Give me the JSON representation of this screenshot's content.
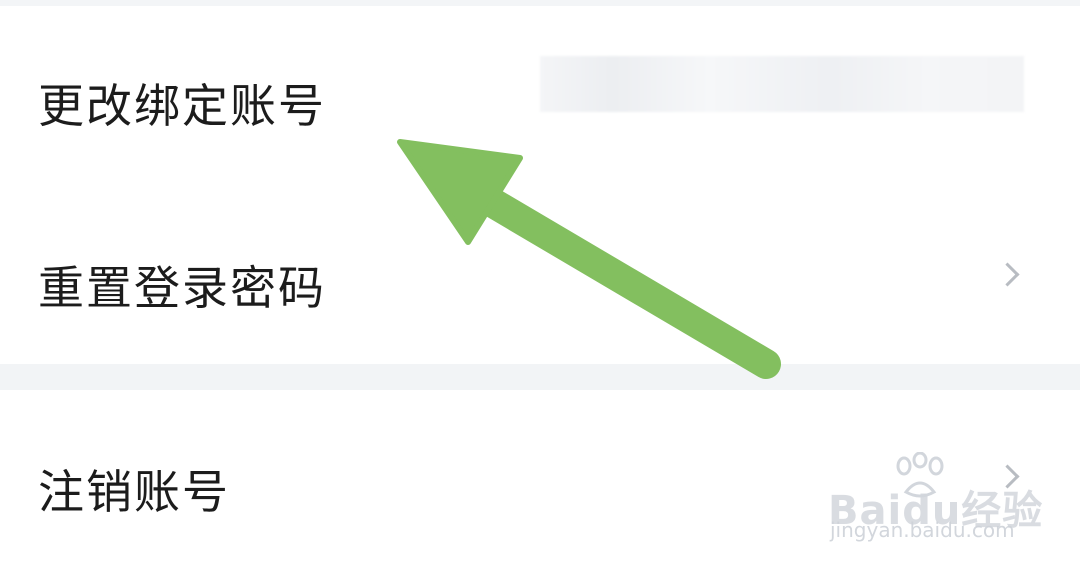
{
  "settings": {
    "rows": [
      {
        "label": "更改绑定账号",
        "value": "",
        "has_chevron": false
      },
      {
        "label": "重置登录密码",
        "has_chevron": true
      },
      {
        "label": "注销账号",
        "has_chevron": true
      }
    ]
  },
  "watermark": {
    "logo": "Baidu经验",
    "url": "jingyan.baidu.com"
  },
  "colors": {
    "arrow": "#83bf5f",
    "text": "#1c1c1c",
    "chevron": "#b8bcc2",
    "divider": "#f2f4f6"
  },
  "icons": {
    "chevron": "chevron-right-icon",
    "annotation": "annotation-arrow-icon"
  }
}
